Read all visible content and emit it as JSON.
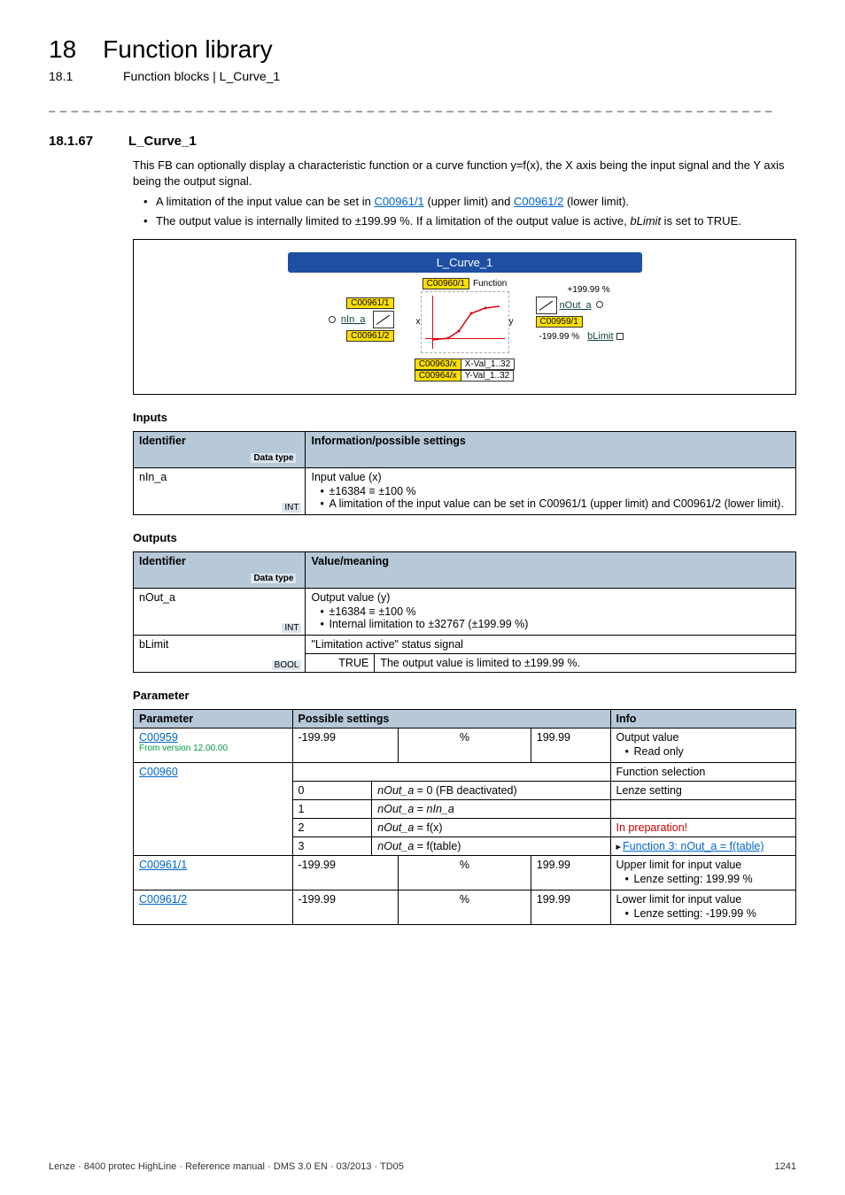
{
  "header": {
    "chapter_num": "18",
    "chapter_title": "Function library",
    "sub_num": "18.1",
    "sub_title": "Function blocks | L_Curve_1"
  },
  "dash_line": "_ _ _ _ _ _ _ _ _ _ _ _ _ _ _ _ _ _ _ _ _ _ _ _ _ _ _ _ _ _ _ _ _ _ _ _ _ _ _ _ _ _ _ _ _ _ _ _ _ _ _ _ _ _ _ _ _ _ _ _ _ _ _ _",
  "section": {
    "num": "18.1.67",
    "title": "L_Curve_1"
  },
  "intro": {
    "p1": "This FB can optionally display a characteristic function or a curve function y=f(x), the X axis being the input signal and the Y axis being the output signal.",
    "b1_pre": "A limitation of the input value can be set in ",
    "b1_link1": "C00961/1",
    "b1_mid": " (upper limit) and ",
    "b1_link2": "C00961/2",
    "b1_post": " (lower limit).",
    "b2_pre": "The output value is internally limited to ±199.99 %. If a limitation of the output value is active, ",
    "b2_i": "bLimit",
    "b2_post": " is set to TRUE."
  },
  "diagram": {
    "title": "L_Curve_1",
    "in_label": "nIn_a",
    "lim_top": "C00961/1",
    "lim_bot": "C00961/2",
    "func_chip": "C00960/1",
    "func_label": "Function",
    "x": "x",
    "y": "y",
    "xchip_l": "C00963/x",
    "xchip_r": "X-Val_1..32",
    "ychip_l": "C00964/x",
    "ychip_r": "Y-Val_1..32",
    "plus": "+199.99 %",
    "minus": "-199.99 %",
    "out_label": "nOut_a",
    "out_chip": "C00959/1",
    "blimit": "bLimit"
  },
  "inputs": {
    "head": "Inputs",
    "col1": "Identifier",
    "col1_sub": "Data type",
    "col2": "Information/possible settings",
    "row_id": "nIn_a",
    "row_type": "INT",
    "row_desc_line1": "Input value (x)",
    "row_desc_b1": "±16384 ≡ ±100 %",
    "row_desc_b2": "A limitation of the input value can be set in C00961/1 (upper limit) and C00961/2 (lower limit)."
  },
  "outputs": {
    "head": "Outputs",
    "col1": "Identifier",
    "col1_sub": "Data type",
    "col2": "Value/meaning",
    "r1_id": "nOut_a",
    "r1_type": "INT",
    "r1_l1": "Output value (y)",
    "r1_b1": "±16384 ≡ ±100 %",
    "r1_b2": "Internal limitation to ±32767 (±199.99 %)",
    "r2_id": "bLimit",
    "r2_type": "BOOL",
    "r2_l1": "\"Limitation active\" status signal",
    "r2_true": "TRUE",
    "r2_true_desc": "The output value is limited to ±199.99 %."
  },
  "params": {
    "head": "Parameter",
    "col1": "Parameter",
    "col2": "Possible settings",
    "col3": "Info",
    "rows": [
      {
        "p_link": "C00959",
        "p_sub": "From version 12.00.00",
        "min": "-199.99",
        "unit": "%",
        "max": "199.99",
        "info_l1": "Output value",
        "info_b1": "Read only"
      }
    ],
    "c00960": {
      "p_link": "C00960",
      "info": "Function selection",
      "opts": [
        {
          "n": "0",
          "d_pre": "nOut_a",
          "d_mid": " = 0 (FB deactivated)",
          "info": "Lenze setting"
        },
        {
          "n": "1",
          "d_pre": "nOut_a",
          "d_mid": " = ",
          "d_i2": "nIn_a",
          "info": ""
        },
        {
          "n": "2",
          "d_pre": "nOut_a",
          "d_mid": " = f(x)",
          "info": "In preparation!",
          "red": true
        },
        {
          "n": "3",
          "d_pre": "nOut_a",
          "d_mid": " = f(table)",
          "info_link": "Function 3: nOut_a = f(table)"
        }
      ]
    },
    "c00961_1": {
      "p_link": "C00961/1",
      "min": "-199.99",
      "unit": "%",
      "max": "199.99",
      "info_l1": "Upper limit for input value",
      "info_b1": "Lenze setting: 199.99 %"
    },
    "c00961_2": {
      "p_link": "C00961/2",
      "min": "-199.99",
      "unit": "%",
      "max": "199.99",
      "info_l1": "Lower limit for input value",
      "info_b1": "Lenze setting: -199.99 %"
    }
  },
  "footer": {
    "left": "Lenze · 8400 protec HighLine · Reference manual · DMS 3.0 EN · 03/2013 · TD05",
    "right": "1241"
  }
}
